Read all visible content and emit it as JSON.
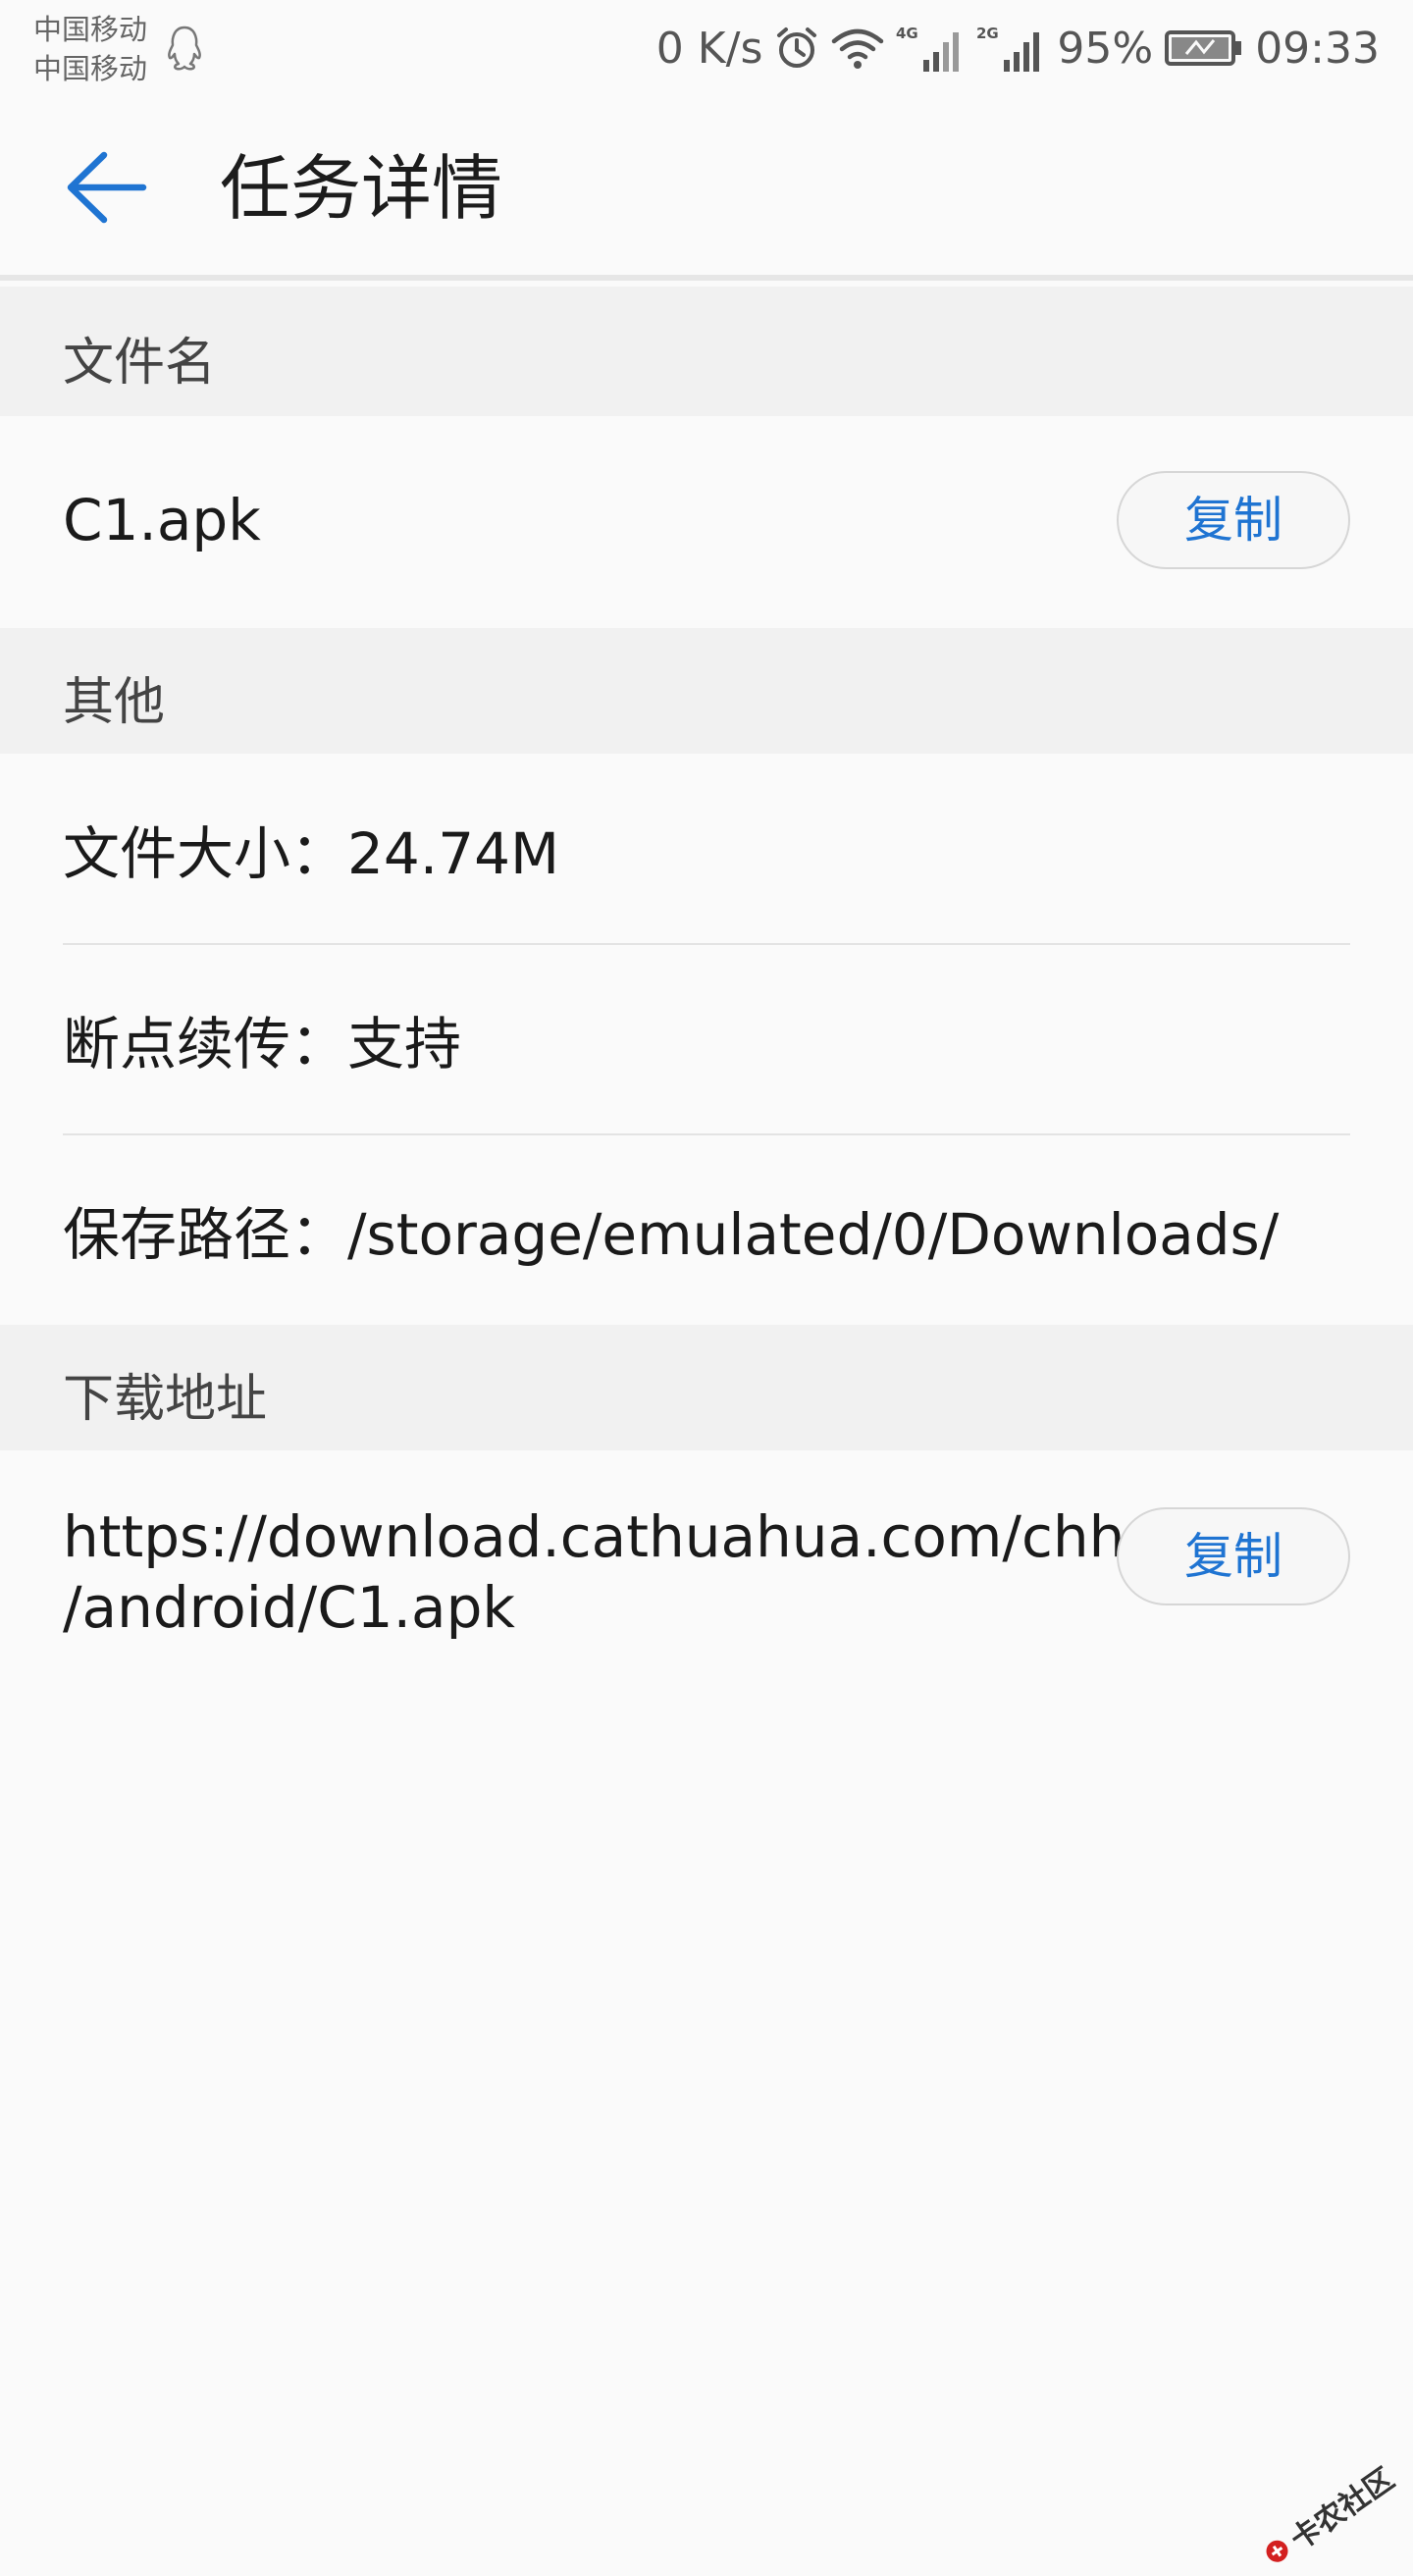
{
  "status_bar": {
    "carrier_1": "中国移动",
    "carrier_2": "中国移动",
    "net_speed": "0 K/s",
    "network_1": "4G",
    "network_2": "2G",
    "battery_pct": "95%",
    "time": "09:33"
  },
  "header": {
    "title": "任务详情",
    "accent_color": "#1f74d2"
  },
  "sections": {
    "file_name": {
      "label": "文件名",
      "value": "C1.apk",
      "copy_label": "复制"
    },
    "other": {
      "label": "其他",
      "file_size": "文件大小：24.74M",
      "resume": "断点续传：支持",
      "save_path": "保存路径：/storage/emulated/0/Downloads/"
    },
    "download_url": {
      "label": "下载地址",
      "url_line_1": "https://download.cathuahua.com/chh",
      "url_line_2": "/android/C1.apk",
      "copy_label": "复制"
    }
  },
  "watermark": {
    "text": "卡农社区"
  }
}
